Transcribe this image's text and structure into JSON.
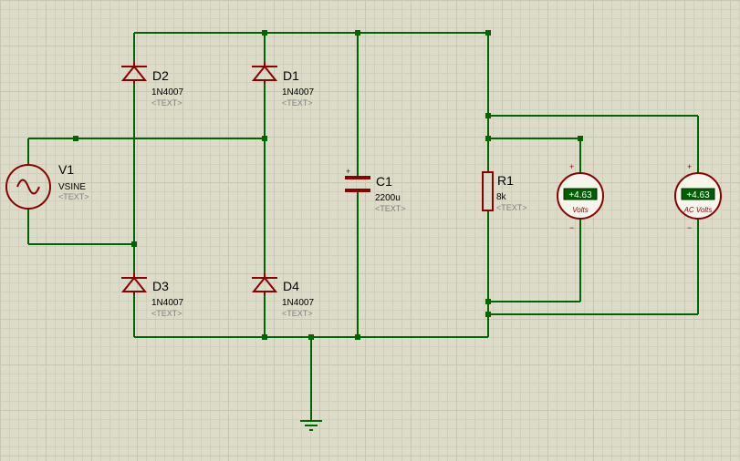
{
  "components": {
    "v1": {
      "ref": "V1",
      "value": "VSINE",
      "text": "<TEXT>"
    },
    "d1": {
      "ref": "D1",
      "value": "1N4007",
      "text": "<TEXT>"
    },
    "d2": {
      "ref": "D2",
      "value": "1N4007",
      "text": "<TEXT>"
    },
    "d3": {
      "ref": "D3",
      "value": "1N4007",
      "text": "<TEXT>"
    },
    "d4": {
      "ref": "D4",
      "value": "1N4007",
      "text": "<TEXT>"
    },
    "c1": {
      "ref": "C1",
      "value": "2200u",
      "text": "<TEXT>"
    },
    "r1": {
      "ref": "R1",
      "value": "8k",
      "text": "<TEXT>"
    }
  },
  "meters": {
    "dc_voltmeter": {
      "reading": "+4.63",
      "unit": "Volts",
      "plus": "+",
      "minus": "−"
    },
    "ac_voltmeter": {
      "reading": "+4.63",
      "unit": "AC Volts",
      "plus": "+",
      "minus": "−"
    }
  },
  "colors": {
    "wire": "#006400",
    "component": "#8b0000",
    "background": "#dcdcc8"
  }
}
